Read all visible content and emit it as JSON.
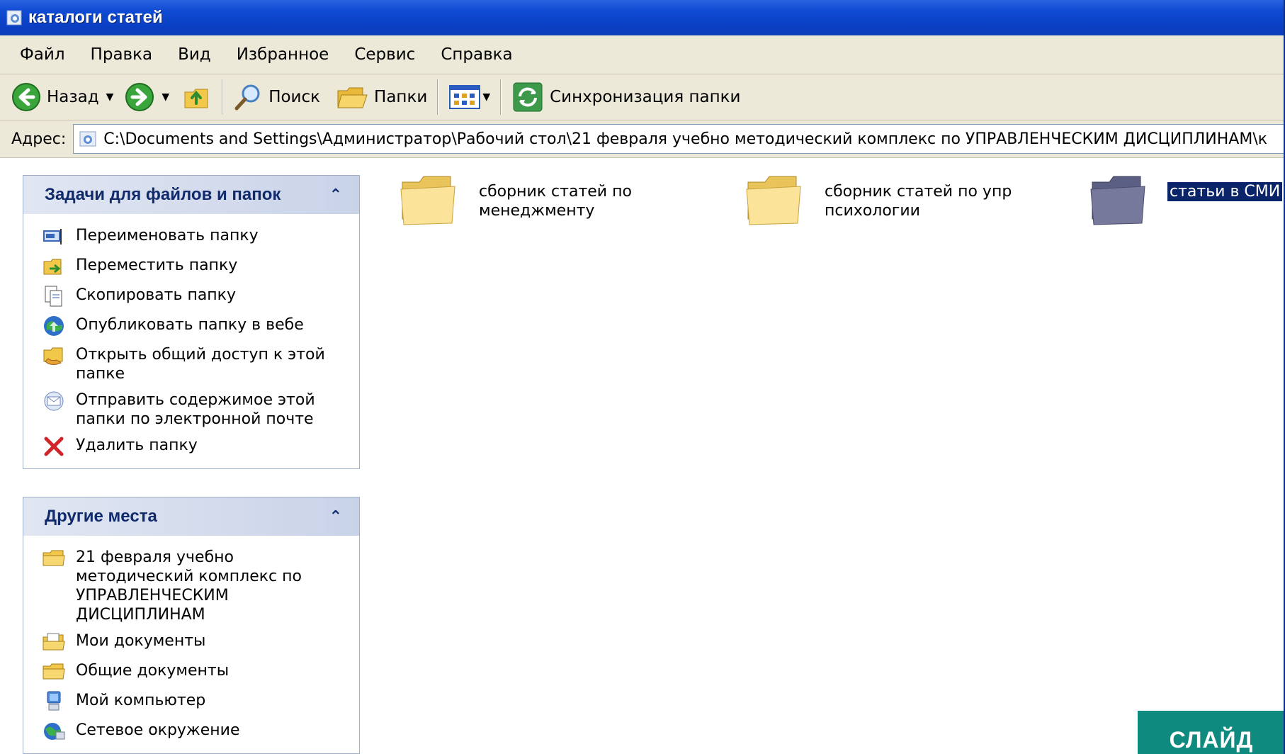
{
  "window": {
    "title": "каталоги статей"
  },
  "menu": [
    "Файл",
    "Правка",
    "Вид",
    "Избранное",
    "Сервис",
    "Справка"
  ],
  "toolbar": {
    "back": "Назад",
    "search": "Поиск",
    "folders": "Папки",
    "sync": "Синхронизация папки"
  },
  "address": {
    "label": "Адрес:",
    "path": "C:\\Documents and Settings\\Администратор\\Рабочий стол\\21 февраля учебно методический комплекс по УПРАВЛЕНЧЕСКИМ ДИСЦИПЛИНАМ\\к"
  },
  "tasks": {
    "title": "Задачи для файлов и папок",
    "items": [
      {
        "label": "Переименовать папку",
        "icon": "rename-icon"
      },
      {
        "label": "Переместить папку",
        "icon": "move-icon"
      },
      {
        "label": "Скопировать папку",
        "icon": "copy-icon"
      },
      {
        "label": "Опубликовать папку в вебе",
        "icon": "publish-web-icon"
      },
      {
        "label": "Открыть общий доступ к этой папке",
        "icon": "share-icon"
      },
      {
        "label": "Отправить содержимое этой папки по электронной почте",
        "icon": "email-icon"
      },
      {
        "label": "Удалить папку",
        "icon": "delete-icon"
      }
    ]
  },
  "places": {
    "title": "Другие места",
    "items": [
      {
        "label": "21 февраля учебно методический комплекс по УПРАВЛЕНЧЕСКИМ ДИСЦИПЛИНАМ",
        "icon": "folder-icon"
      },
      {
        "label": "Мои документы",
        "icon": "my-documents-icon"
      },
      {
        "label": "Общие документы",
        "icon": "folder-icon"
      },
      {
        "label": "Мой компьютер",
        "icon": "my-computer-icon"
      },
      {
        "label": "Сетевое окружение",
        "icon": "network-icon"
      }
    ]
  },
  "folders": [
    {
      "name": "сборник статей по менеджменту",
      "selected": false
    },
    {
      "name": "сборник статей по упр психологии",
      "selected": false
    },
    {
      "name": "статьи в СМИ",
      "selected": true
    }
  ],
  "slide_badge": "СЛАЙД",
  "colors": {
    "titlebar": "#0a3fc4",
    "selection": "#0a246a",
    "panel_header_text": "#102a6b",
    "slide_badge": "#0f8a7e"
  }
}
